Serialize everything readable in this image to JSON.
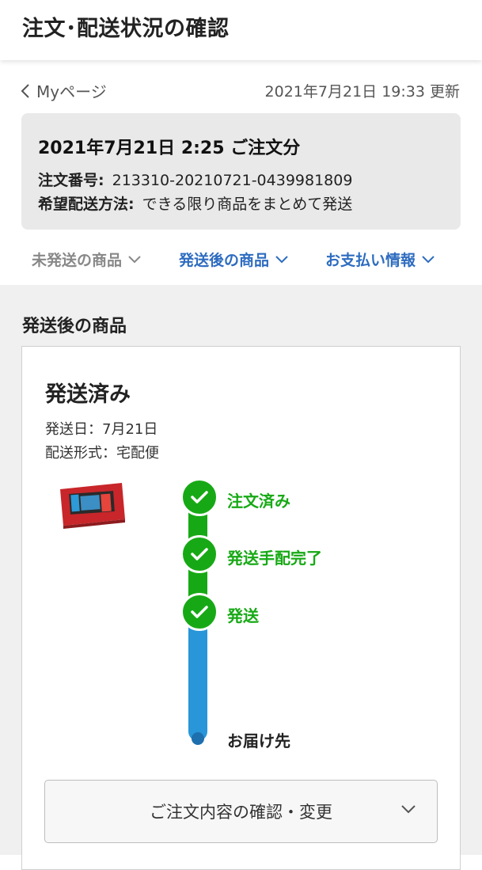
{
  "header": {
    "title": "注文･配送状況の確認"
  },
  "nav": {
    "back_label": "Myページ",
    "updated": "2021年7月21日 19:33 更新"
  },
  "order": {
    "date": "2021年7月21日 2:25 ご注文分",
    "number_label": "注文番号:",
    "number_value": "213310-20210721-0439981809",
    "method_label": "希望配送方法:",
    "method_value": "できる限り商品をまとめて発送"
  },
  "tabs": [
    {
      "label": "未発送の商品",
      "active": false
    },
    {
      "label": "発送後の商品",
      "active": true
    },
    {
      "label": "お支払い情報",
      "active": true
    }
  ],
  "section": {
    "title": "発送後の商品",
    "status": "発送済み",
    "ship_date": "発送日：7月21日",
    "ship_type": "配送形式：宅配便"
  },
  "steps": [
    {
      "label": "注文済み",
      "done": true
    },
    {
      "label": "発送手配完了",
      "done": true
    },
    {
      "label": "発送",
      "done": true
    },
    {
      "label": "お届け先",
      "done": false
    }
  ],
  "confirm_button": {
    "label": "ご注文内容の確認・変更"
  },
  "colors": {
    "green": "#17a915",
    "blue": "#2896d8",
    "link": "#2e6cc0"
  }
}
